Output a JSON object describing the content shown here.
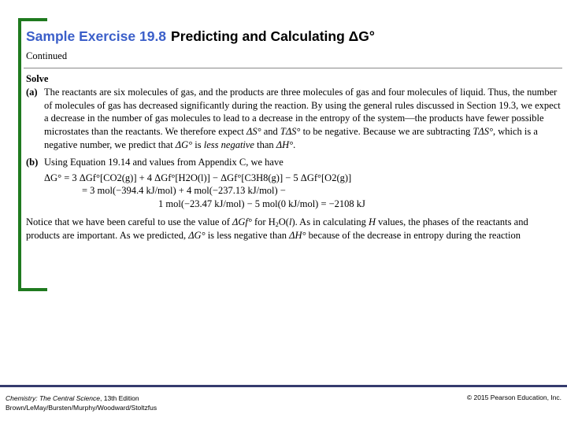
{
  "header": {
    "exercise_number": "Sample Exercise 19.8",
    "exercise_title": "Predicting and Calculating ΔG°",
    "subtitle": "Continued"
  },
  "solve": {
    "heading": "Solve",
    "part_a": {
      "label": "(a)",
      "seg1": "The reactants are six molecules of gas, and the products are three molecules of gas and four molecules of liquid. Thus, the number of molecules of gas has decreased significantly during the reaction. By using the general rules discussed in Section 19.3, we expect a decrease in the number of gas molecules to lead to a decrease in the entropy of the system—the products have fewer possible microstates than the reactants. We therefore expect ",
      "dS": "ΔS°",
      "seg2": " and ",
      "TdS": "TΔS°",
      "seg3": " to be negative. Because we are subtracting ",
      "TdS2": "TΔS°",
      "seg4": ", which is a negative number, we predict that ",
      "dG": "ΔG°",
      "seg5": " is ",
      "emph": "less negative",
      "seg6": " than ",
      "dH": "ΔH°",
      "seg7": "."
    },
    "part_b": {
      "label": "(b)",
      "intro": "Using Equation 19.14 and values from Appendix C, we have",
      "equation_line1": "ΔG° = 3 ΔGf°[CO2(g)] + 4 ΔGf°[H2O(l)] − ΔGf°[C3H8(g)] − 5 ΔGf°[O2(g)]",
      "equation_line2": "= 3 mol(−394.4 kJ/mol) + 4 mol(−237.13 kJ/mol) −",
      "equation_line3": "1 mol(−23.47 kJ/mol) − 5 mol(0 kJ/mol) = −2108 kJ"
    },
    "notice": {
      "seg1": "Notice that we have been careful to use the value of ",
      "dGf": "ΔGf°",
      "seg2": " for H",
      "sub2": "2",
      "seg3": "O(",
      "l": "l",
      "seg4": "). As in calculating ",
      "H": "H",
      "seg5": " values, the phases of the reactants and products are important. As we predicted, ",
      "dG": "ΔG°",
      "seg6": " is less negative than ",
      "dH": "ΔH°",
      "seg7": " because of the decrease in entropy during the reaction"
    }
  },
  "footer": {
    "book_title": "Chemistry: The Central Science",
    "edition": ", 13th Edition",
    "authors": "Brown/LeMay/Bursten/Murphy/Woodward/Stoltzfus",
    "copyright": "© 2015 Pearson Education, Inc."
  },
  "colors": {
    "accent_blue": "#3b5fc9",
    "bracket_green": "#1f7a1f",
    "footer_bar": "#353b6e"
  }
}
